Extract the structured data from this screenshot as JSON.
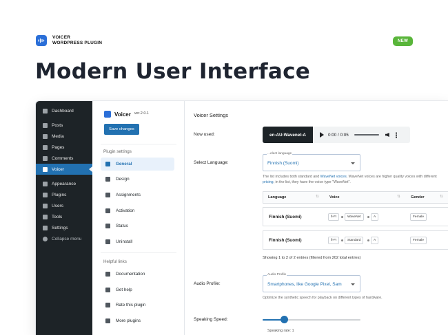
{
  "brand": {
    "line1": "VOICER",
    "line2": "WORDPRESS PLUGIN",
    "logo_icon": "waveform-icon",
    "color": "#2b6fd8"
  },
  "badge": "NEW",
  "hero_title": "Modern User Interface",
  "wp_menu": [
    {
      "label": "Dashboard",
      "icon": "dashboard-icon"
    },
    {
      "label": "Posts",
      "icon": "pin-icon"
    },
    {
      "label": "Media",
      "icon": "media-icon"
    },
    {
      "label": "Pages",
      "icon": "pages-icon"
    },
    {
      "label": "Comments",
      "icon": "comments-icon"
    },
    {
      "label": "Voicer",
      "icon": "voicer-icon",
      "active": true
    },
    {
      "label": "Appearance",
      "icon": "brush-icon"
    },
    {
      "label": "Plugins",
      "icon": "plugin-icon"
    },
    {
      "label": "Users",
      "icon": "users-icon"
    },
    {
      "label": "Tools",
      "icon": "wrench-icon"
    },
    {
      "label": "Settings",
      "icon": "settings-icon"
    },
    {
      "label": "Collapse menu",
      "icon": "collapse-icon"
    }
  ],
  "plugin": {
    "name": "Voicer",
    "version": "ver.2.0.1",
    "save_label": "Save changes",
    "settings_heading": "Plugin settings",
    "settings_links": [
      {
        "label": "General",
        "icon": "sliders-icon",
        "active": true
      },
      {
        "label": "Design",
        "icon": "brush-icon"
      },
      {
        "label": "Assignments",
        "icon": "flag-icon"
      },
      {
        "label": "Activation",
        "icon": "key-icon"
      },
      {
        "label": "Status",
        "icon": "info-icon"
      },
      {
        "label": "Uninstall",
        "icon": "trash-icon"
      }
    ],
    "helpful_heading": "Helpful links",
    "helpful_links": [
      {
        "label": "Documentation",
        "icon": "book-icon"
      },
      {
        "label": "Get help",
        "icon": "mail-icon"
      },
      {
        "label": "Rate this plugin",
        "icon": "thumbs-up-icon"
      },
      {
        "label": "More plugins",
        "icon": "store-icon"
      }
    ]
  },
  "main": {
    "title": "Voicer Settings",
    "now_used_label": "Now used:",
    "audio": {
      "voice": "en-AU-Wavenet-A",
      "time": "0:00 / 0:05"
    },
    "language_label": "Select Language:",
    "language_select": {
      "label": "...elect language",
      "value": "Finnish (Suomi)"
    },
    "language_help_1": "The list includes both standard and",
    "language_help_link1": "WaveNet voices",
    "language_help_2": ". WaveNet voices are higher quality",
    "language_help_3": "voices with different",
    "language_help_link2": "pricing",
    "language_help_4": ", in the list, they have the voice type \"WaveNet\".",
    "table": {
      "headers": [
        "Language",
        "Voice",
        "Gender"
      ],
      "rows": [
        {
          "language": "Finnish (Suomi)",
          "code": "fi-FI",
          "type": "WaveNet",
          "variant": "A",
          "gender": "Female"
        },
        {
          "language": "Finnish (Suomi)",
          "code": "fi-FI",
          "type": "Standard",
          "variant": "A",
          "gender": "Female"
        }
      ]
    },
    "entries": "Showing 1 to 2 of 2 entries (filtered from 202 total entries)",
    "audio_profile_label": "Audio Profile:",
    "audio_profile_select": {
      "label": "Audio Profile",
      "value": "Smartphones, like Google Pixel, Sam"
    },
    "audio_profile_help": "Optimize the synthetic speech for playback on different types of hardware.",
    "speed_label": "Speaking Speed:",
    "speed_rate": "Speaking rate: 1",
    "speed_value": 0.22
  },
  "colors": {
    "accent": "#2271b1",
    "sidebar": "#1d2327",
    "badge": "#59b53a"
  }
}
